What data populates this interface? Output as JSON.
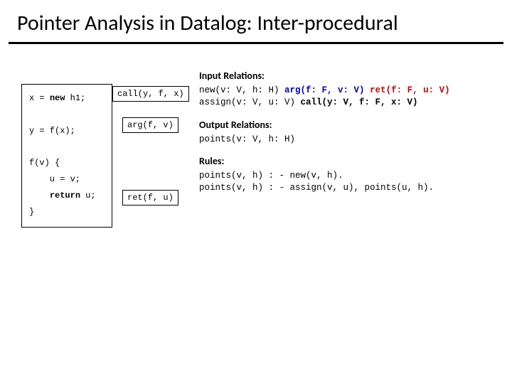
{
  "title": "Pointer Analysis in Datalog: Inter-procedural",
  "code": {
    "line1a": "x = ",
    "line1_kw": "new",
    "line1b": " h1;",
    "line2": "y = f(x);",
    "line3": "f(v) {",
    "line4": "    u = v;",
    "line5a": "    ",
    "line5_kw": "return",
    "line5b": " u;",
    "line6": "}"
  },
  "labels": {
    "call": "call(y, f, x)",
    "arg": "arg(f, v)",
    "ret": "ret(f, u)"
  },
  "right": {
    "input_head": "Input Relations:",
    "input1_a": "new(v: V, h: H)  ",
    "input1_arg": "arg(f: F, v: V)",
    "input1_sp": "  ",
    "input1_ret": "ret(f: F, u: V)",
    "input2_a": "assign(v: V, u: V)  ",
    "input2_call": "call(y: V, f: F, x: V)",
    "output_head": "Output Relations:",
    "output1": "points(v: V, h: H)",
    "rules_head": "Rules:",
    "rule1": "points(v, h) : - new(v, h).",
    "rule2": "points(v, h) : - assign(v, u), points(u, h)."
  }
}
